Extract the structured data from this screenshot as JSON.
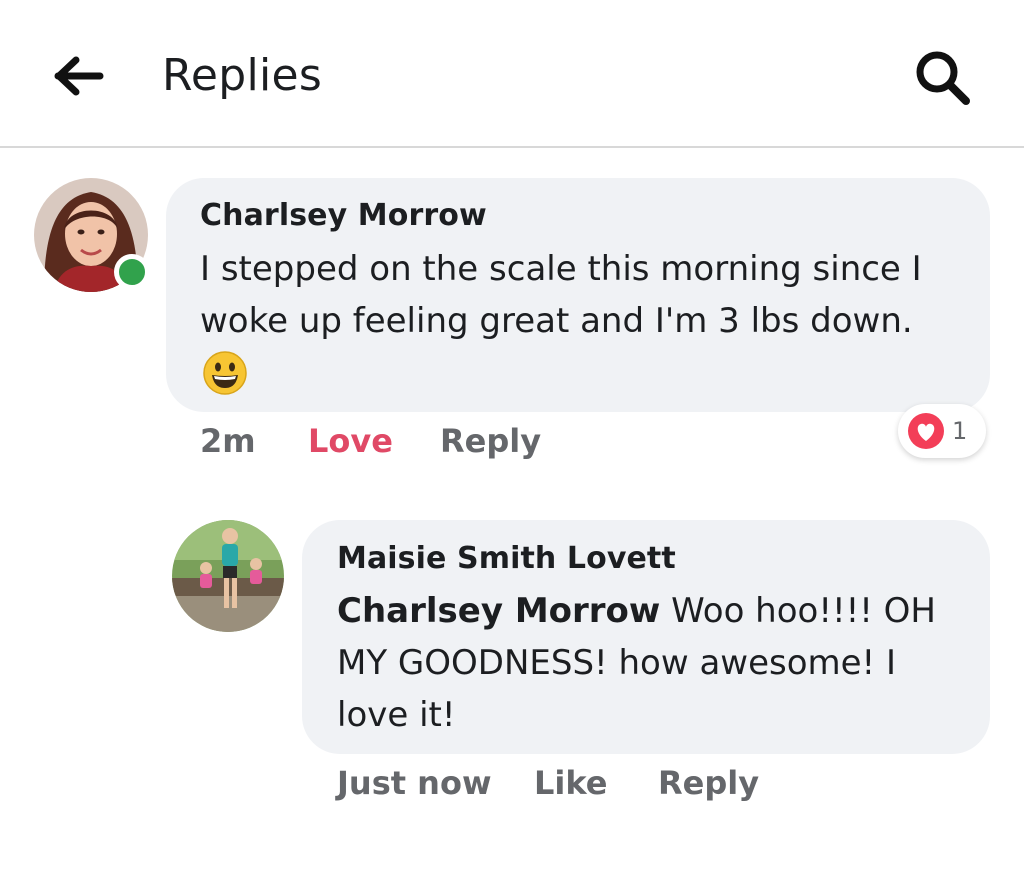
{
  "header": {
    "title": "Replies",
    "back_icon": "arrow-left-icon",
    "search_icon": "search-icon"
  },
  "comment": {
    "author": "Charlsey Morrow",
    "text_line1": "I stepped on the scale this morning since I",
    "text_line2": "woke up feeling great and I'm 3 lbs down.",
    "emoji": "grinning-face-icon",
    "time": "2m",
    "reaction_label": "Love",
    "reply_label": "Reply",
    "reaction_icon": "heart-icon",
    "reaction_count": "1",
    "online": true
  },
  "reply": {
    "author": "Maisie Smith Lovett",
    "mention": "Charlsey Morrow",
    "text_line1": " Woo hoo!!!! OH",
    "text_line2": "MY GOODNESS! how awesome! I",
    "text_line3": "love it!",
    "time": "Just now",
    "like_label": "Like",
    "reply_label": "Reply"
  },
  "colors": {
    "bubble": "#f0f2f5",
    "love": "#e04966",
    "meta": "#65676b",
    "online": "#31a24c",
    "heart": "#f33e58"
  }
}
